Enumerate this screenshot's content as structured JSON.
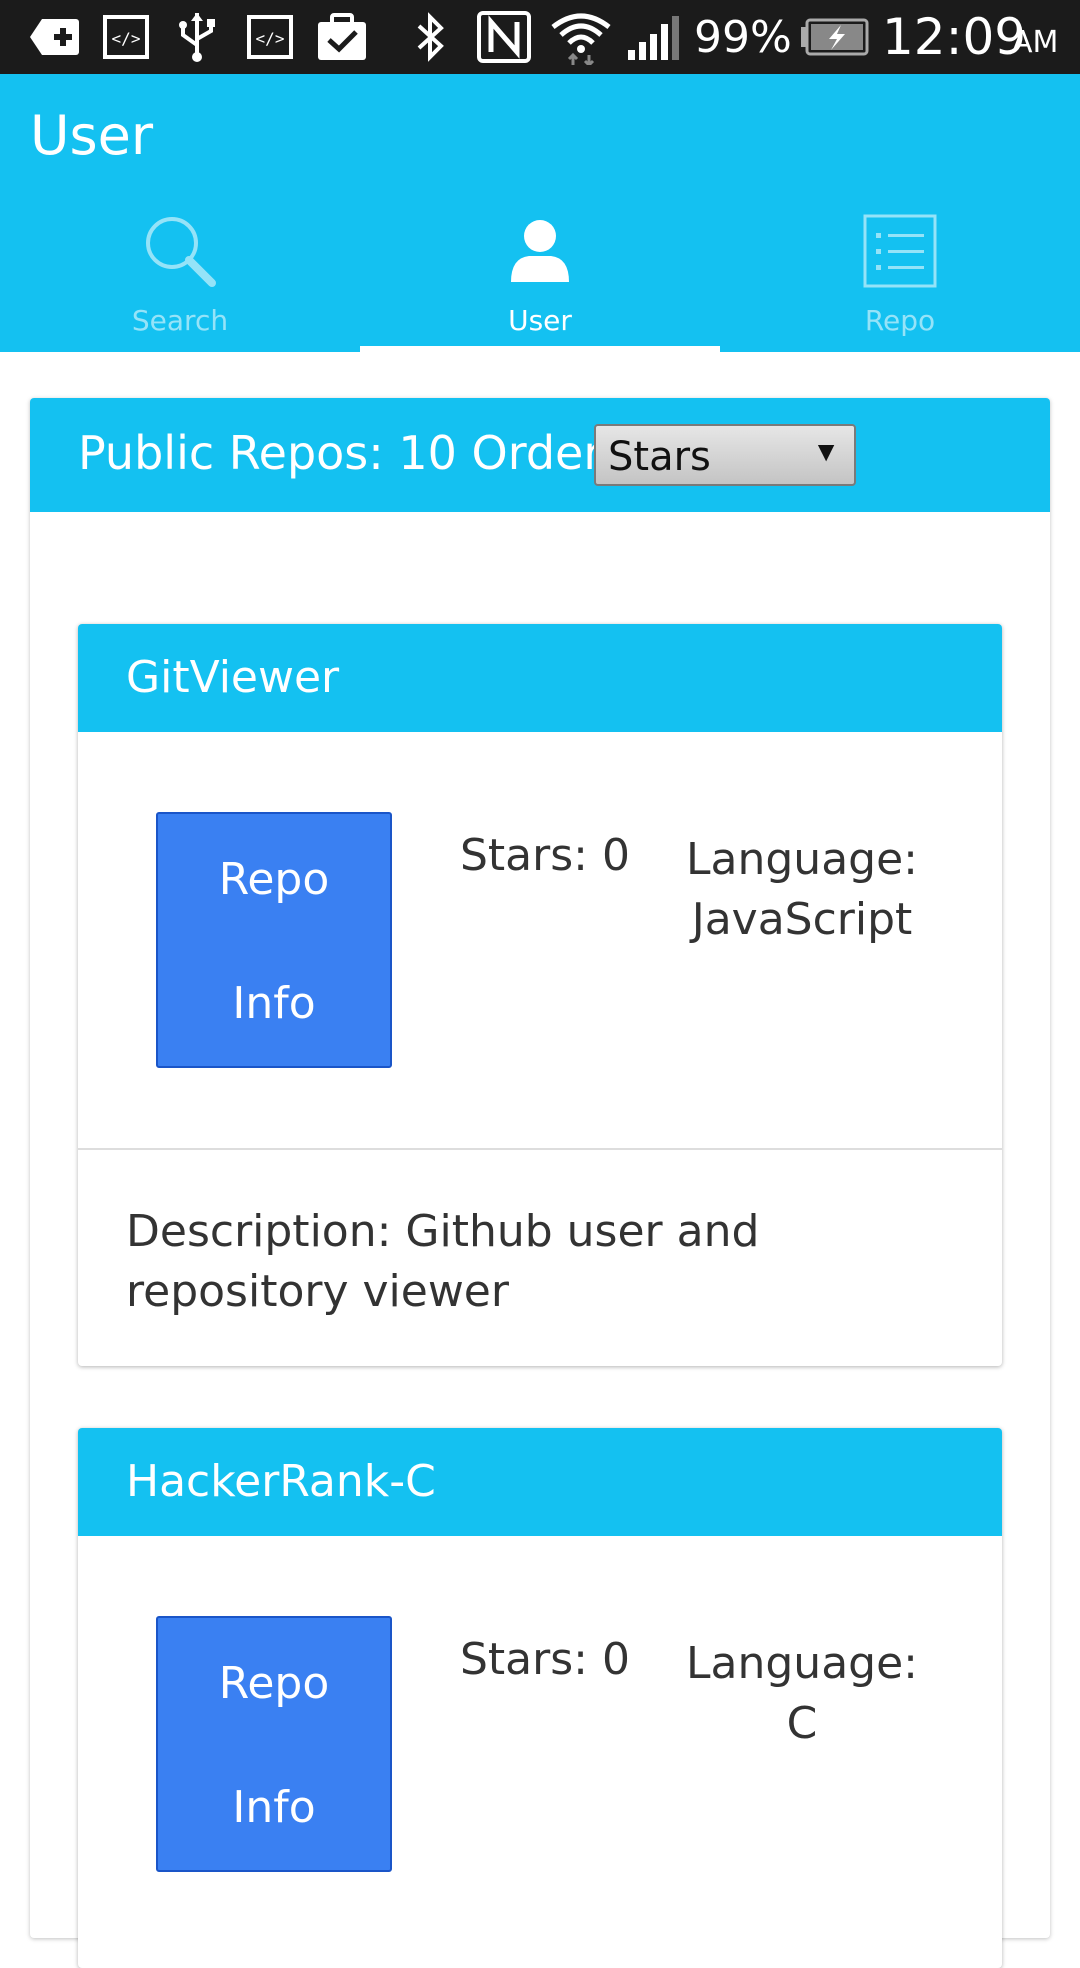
{
  "status_bar": {
    "battery_percent": "99%",
    "time": "12:09",
    "ampm": "AM",
    "icons": [
      "add-box-icon",
      "code-icon",
      "usb-icon",
      "code-icon",
      "clipboard-check-icon",
      "bluetooth-icon",
      "nfc-icon",
      "wifi-icon",
      "signal-icon",
      "battery-charging-icon"
    ]
  },
  "app_bar": {
    "title": "User"
  },
  "tabs": [
    {
      "label": "Search",
      "icon": "search-icon",
      "active": false
    },
    {
      "label": "User",
      "icon": "user-icon",
      "active": true
    },
    {
      "label": "Repo",
      "icon": "list-icon",
      "active": false
    }
  ],
  "repos_header": {
    "label": "Public Repos: 10 Order:",
    "order_selected": "Stars"
  },
  "repos": [
    {
      "name": "GitViewer",
      "button_line1": "Repo",
      "button_line2": "Info",
      "stars": "Stars: 0",
      "language_label": "Language:",
      "language": "JavaScript",
      "description": "Description: Github user and repository viewer"
    },
    {
      "name": "HackerRank-C",
      "button_line1": "Repo",
      "button_line2": "Info",
      "stars": "Stars: 0",
      "language_label": "Language:",
      "language": "C"
    }
  ],
  "colors": {
    "primary": "#14c1f1",
    "button": "#3a80f2",
    "status_bar": "#1b1b1b"
  }
}
